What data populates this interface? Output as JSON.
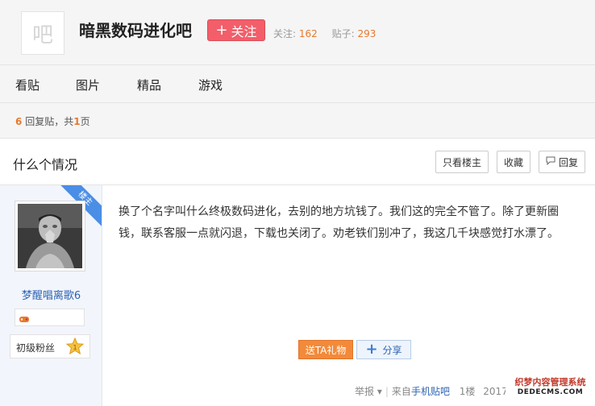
{
  "forum": {
    "logo_char": "吧",
    "name": "暗黑数码进化吧",
    "follow_label": "关注",
    "followers_label": "关注:",
    "followers_count": "162",
    "posts_label": "贴子:",
    "posts_count": "293"
  },
  "nav": {
    "items": [
      "看贴",
      "图片",
      "精品",
      "游戏"
    ]
  },
  "reply_info": {
    "reply_count": "6",
    "reply_text": "回复贴，共",
    "page_count": "1",
    "page_text": "页"
  },
  "thread": {
    "title": "什么个情况",
    "buttons": {
      "only_op": "只看楼主",
      "favorite": "收藏",
      "reply": "回复"
    }
  },
  "post": {
    "ribbon": "楼主",
    "username": "梦醒唱离歌6",
    "level_title": "初级粉丝",
    "level_number": "1",
    "content": "换了个名字叫什么终极数码进化，去别的地方坑钱了。我们这的完全不管了。除了更新圈钱，联系客服一点就闪退，下载也关闭了。劝老铁们别冲了，我这几千块感觉打水漂了。",
    "gift_button": "送TA礼物",
    "share_button": "分享",
    "footer": {
      "report": "举报",
      "source_prefix": "来自",
      "source_link": "手机贴吧",
      "floor": "1楼",
      "date": "2017-1"
    }
  },
  "watermark": {
    "line1": "织梦内容管理系统",
    "line2": "DEDECMS.COM"
  },
  "colors": {
    "follow_button": "#f25e6a",
    "accent_orange": "#e8792f",
    "link_blue": "#2d64b3",
    "ribbon_blue": "#4a8ee6"
  }
}
